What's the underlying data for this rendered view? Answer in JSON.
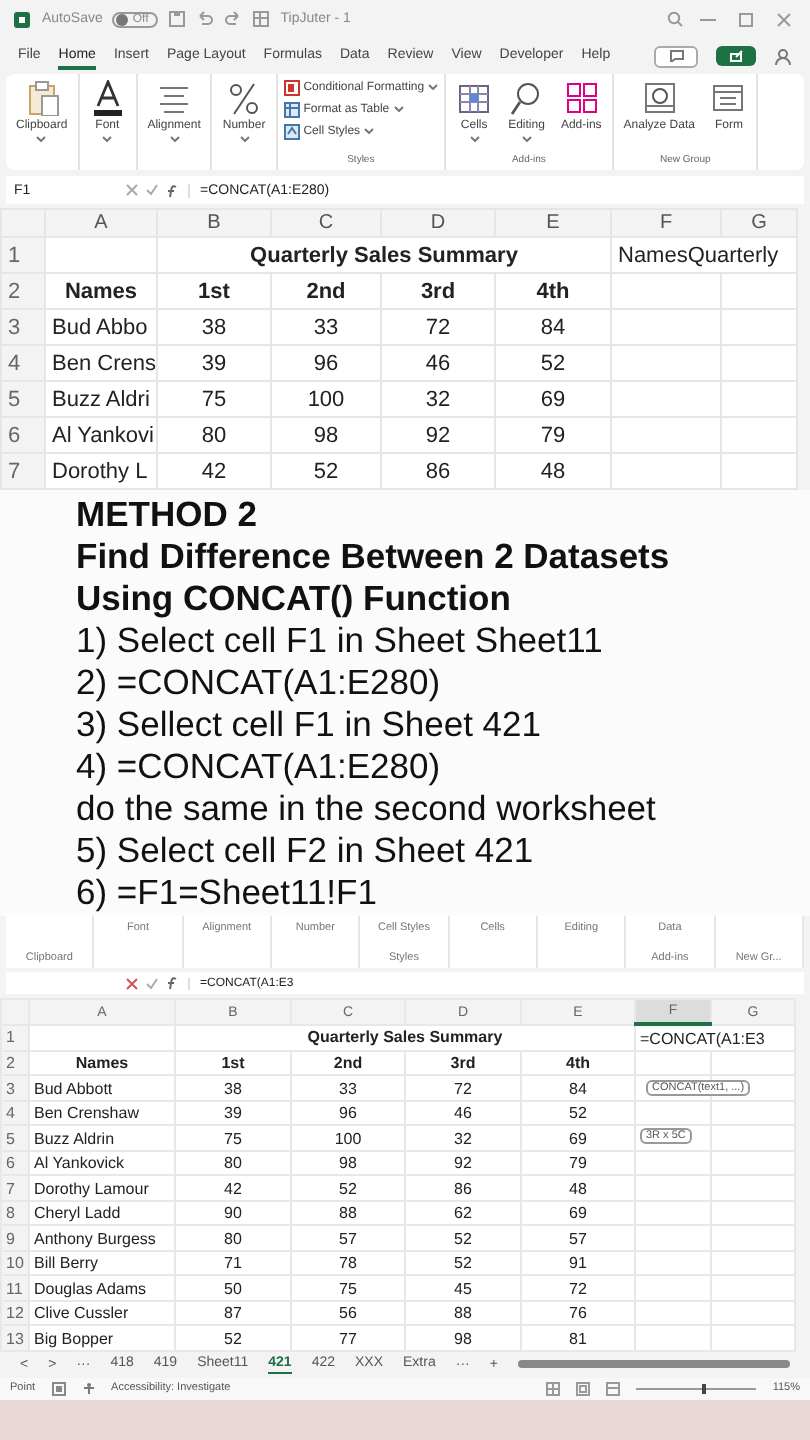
{
  "top_window": {
    "title_bar": {
      "autosave": "AutoSave",
      "autosave_state": "Off",
      "document": "TipJuter - 1"
    },
    "menu_tabs": [
      {
        "label": "File",
        "selected": false
      },
      {
        "label": "Home",
        "selected": true
      },
      {
        "label": "Insert",
        "selected": false
      },
      {
        "label": "Page Layout",
        "selected": false
      },
      {
        "label": "Formulas",
        "selected": false
      },
      {
        "label": "Data",
        "selected": false
      },
      {
        "label": "Review",
        "selected": false
      },
      {
        "label": "View",
        "selected": false
      },
      {
        "label": "Developer",
        "selected": false
      },
      {
        "label": "Help",
        "selected": false
      }
    ],
    "ribbon": [
      {
        "kind": "large",
        "label": "Clipboard",
        "dropdown": true
      },
      {
        "kind": "large",
        "label": "Font",
        "dropdown": true
      },
      {
        "kind": "large",
        "label": "Alignment",
        "dropdown": true
      },
      {
        "kind": "large",
        "label": "Number",
        "dropdown": true
      },
      {
        "kind": "styles",
        "items": [
          "Conditional Formatting",
          "Format as Table",
          "Cell Styles"
        ],
        "caption": "Styles"
      },
      {
        "kind": "large",
        "label": "Cells",
        "dropdown": true
      },
      {
        "kind": "large",
        "label": "Editing",
        "dropdown": true
      },
      {
        "kind": "large",
        "label": "Add-ins",
        "dropdown": false,
        "caption": "Add-ins"
      },
      {
        "kind": "large",
        "label": "Analyze Data",
        "dropdown": false
      },
      {
        "kind": "large",
        "label": "Form",
        "dropdown": false,
        "caption": "New Group"
      }
    ],
    "name_box": "F1",
    "formula": "=CONCAT(A1:E280)",
    "columns": [
      "A",
      "B",
      "C",
      "D",
      "E",
      "F",
      "G"
    ],
    "rows": [
      {
        "number": "1",
        "kind": "title",
        "cells": [
          "",
          {
            "text": "Quarterly Sales Summary",
            "colspan": 4
          },
          {
            "text": "NamesQuarterly",
            "colspan": 2
          }
        ]
      },
      {
        "number": "2",
        "kind": "header",
        "cells": [
          "Names",
          "1st",
          "2nd",
          "3rd",
          "4th",
          "",
          ""
        ]
      },
      {
        "number": "3",
        "kind": "data",
        "cells": [
          "Bud Abbo",
          "38",
          "33",
          "72",
          "84",
          "",
          ""
        ]
      },
      {
        "number": "4",
        "kind": "data",
        "cells": [
          "Ben Crens",
          "39",
          "96",
          "46",
          "52",
          "",
          ""
        ]
      },
      {
        "number": "5",
        "kind": "data",
        "cells": [
          "Buzz Aldri",
          "75",
          "100",
          "32",
          "69",
          "",
          ""
        ]
      },
      {
        "number": "6",
        "kind": "data",
        "cells": [
          "Al Yankovi",
          "80",
          "98",
          "92",
          "79",
          "",
          ""
        ]
      },
      {
        "number": "7",
        "kind": "data",
        "cells": [
          "Dorothy L",
          "42",
          "52",
          "86",
          "48",
          "",
          ""
        ]
      }
    ]
  },
  "overlay": {
    "lines": [
      {
        "kind": "heading",
        "text": "METHOD 2"
      },
      {
        "kind": "heading",
        "text": "Find Difference Between 2 Datasets"
      },
      {
        "kind": "heading",
        "text": "Using CONCAT() Function"
      },
      {
        "kind": "step",
        "text": "1) Select cell F1 in Sheet Sheet11"
      },
      {
        "kind": "step",
        "text": "2) =CONCAT(A1:E280)"
      },
      {
        "kind": "step",
        "text": "3) Sellect cell F1 in Sheet 421"
      },
      {
        "kind": "step",
        "text": "4) =CONCAT(A1:E280)"
      },
      {
        "kind": "step",
        "text": "do the same in the second worksheet"
      },
      {
        "kind": "step",
        "text": "5) Select cell F2 in Sheet 421"
      },
      {
        "kind": "step",
        "text": "6) =F1=Sheet11!F1"
      }
    ]
  },
  "bottom_window": {
    "ribbon_strip": [
      {
        "caption": "Clipboard"
      },
      {
        "label": "Font"
      },
      {
        "label": "Alignment"
      },
      {
        "label": "Number"
      },
      {
        "label": "Cell Styles",
        "caption": "Styles"
      },
      {
        "label": "Cells"
      },
      {
        "label": "Editing"
      },
      {
        "label": "Data",
        "caption": "Add-ins"
      },
      {
        "caption": "New Gr..."
      }
    ],
    "formula": "=CONCAT(A1:E3",
    "columns": [
      {
        "label": "A",
        "selected": false
      },
      {
        "label": "B",
        "selected": false
      },
      {
        "label": "C",
        "selected": false
      },
      {
        "label": "D",
        "selected": false
      },
      {
        "label": "E",
        "selected": false
      },
      {
        "label": "F",
        "selected": true
      },
      {
        "label": "G",
        "selected": false
      }
    ],
    "rows": [
      {
        "number": "1",
        "kind": "title",
        "cells": [
          "",
          {
            "text": "Quarterly Sales Summary",
            "colspan": 4
          },
          {
            "text": "=CONCAT(A1:E3",
            "colspan": 2
          }
        ]
      },
      {
        "number": "2",
        "kind": "header",
        "cells": [
          "Names",
          "1st",
          "2nd",
          "3rd",
          "4th",
          "",
          ""
        ]
      },
      {
        "number": "3",
        "kind": "data",
        "cells": [
          "Bud Abbott",
          "38",
          "33",
          "72",
          "84",
          "",
          ""
        ]
      },
      {
        "number": "4",
        "kind": "data",
        "cells": [
          "Ben Crenshaw",
          "39",
          "96",
          "46",
          "52",
          "",
          ""
        ]
      },
      {
        "number": "5",
        "kind": "data",
        "cells": [
          "Buzz Aldrin",
          "75",
          "100",
          "32",
          "69",
          "",
          ""
        ]
      },
      {
        "number": "6",
        "kind": "data",
        "cells": [
          "Al Yankovick",
          "80",
          "98",
          "92",
          "79",
          "",
          ""
        ]
      },
      {
        "number": "7",
        "kind": "data",
        "cells": [
          "Dorothy Lamour",
          "42",
          "52",
          "86",
          "48",
          "",
          ""
        ]
      },
      {
        "number": "8",
        "kind": "data",
        "cells": [
          "Cheryl Ladd",
          "90",
          "88",
          "62",
          "69",
          "",
          ""
        ]
      },
      {
        "number": "9",
        "kind": "data",
        "cells": [
          "Anthony Burgess",
          "80",
          "57",
          "52",
          "57",
          "",
          ""
        ]
      },
      {
        "number": "10",
        "kind": "data",
        "cells": [
          "Bill Berry",
          "71",
          "78",
          "52",
          "91",
          "",
          ""
        ]
      },
      {
        "number": "11",
        "kind": "data",
        "cells": [
          "Douglas Adams",
          "50",
          "75",
          "45",
          "72",
          "",
          ""
        ]
      },
      {
        "number": "12",
        "kind": "data",
        "cells": [
          "Clive Cussler",
          "87",
          "56",
          "88",
          "76",
          "",
          ""
        ]
      },
      {
        "number": "13",
        "kind": "data",
        "cells": [
          "Big Bopper",
          "52",
          "77",
          "98",
          "81",
          "",
          ""
        ]
      }
    ],
    "tooltips": [
      "CONCAT(text1, ...)",
      "3R x 5C"
    ],
    "sheet_bar": {
      "nav": [
        "<",
        ">",
        "···"
      ],
      "tabs": [
        {
          "label": "418",
          "selected": false
        },
        {
          "label": "419",
          "selected": false
        },
        {
          "label": "Sheet11",
          "selected": false
        },
        {
          "label": "421",
          "selected": true
        },
        {
          "label": "422",
          "selected": false
        },
        {
          "label": "XXX",
          "selected": false
        },
        {
          "label": "Extra",
          "selected": false
        }
      ],
      "more": "···",
      "add": "+"
    },
    "status": {
      "mode": "Point",
      "accessibility": "Accessibility: Investigate",
      "zoom_slider": {
        "level": 0.55
      },
      "zoom": "115%"
    }
  }
}
